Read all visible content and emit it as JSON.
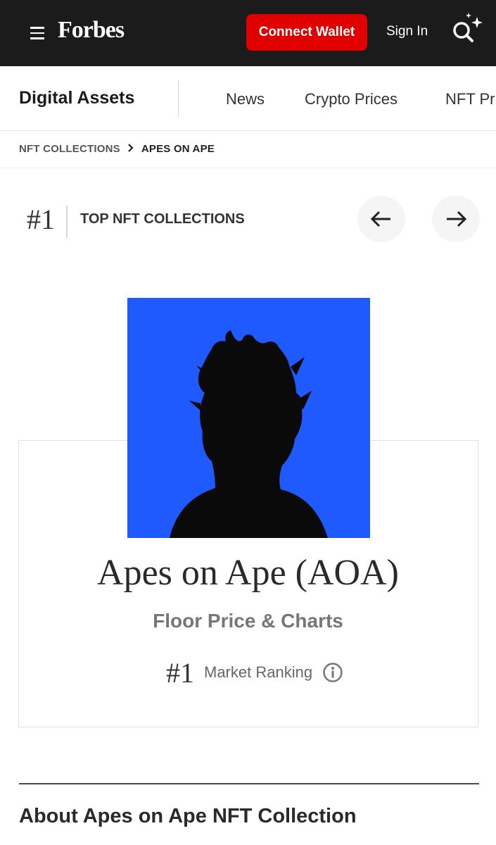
{
  "header": {
    "logo": "Forbes",
    "connect_wallet_label": "Connect Wallet",
    "sign_in_label": "Sign In",
    "menu_icon": "hamburger-menu-icon",
    "search_icon": "search-sparkle-icon",
    "background_color": "#1b1b1b",
    "accent_color": "#e00000"
  },
  "subnav": {
    "title": "Digital Assets",
    "links": [
      "News",
      "Crypto Prices",
      "NFT Prices"
    ]
  },
  "breadcrumb": {
    "items": [
      "NFT COLLECTIONS",
      "APES ON APE"
    ],
    "separator_icon": "chevron-right-icon"
  },
  "ranking_header": {
    "rank": "#1",
    "label": "TOP NFT COLLECTIONS",
    "prev_icon": "arrow-left-icon",
    "next_icon": "arrow-right-icon"
  },
  "collection": {
    "name": "Apes on Ape (AOA)",
    "subtitle": "Floor Price & Charts",
    "rank": "#1",
    "rank_label": "Market Ranking",
    "info_icon": "info-icon",
    "image_background": "#1f5aff"
  },
  "about": {
    "title": "About Apes on Ape NFT Collection"
  }
}
